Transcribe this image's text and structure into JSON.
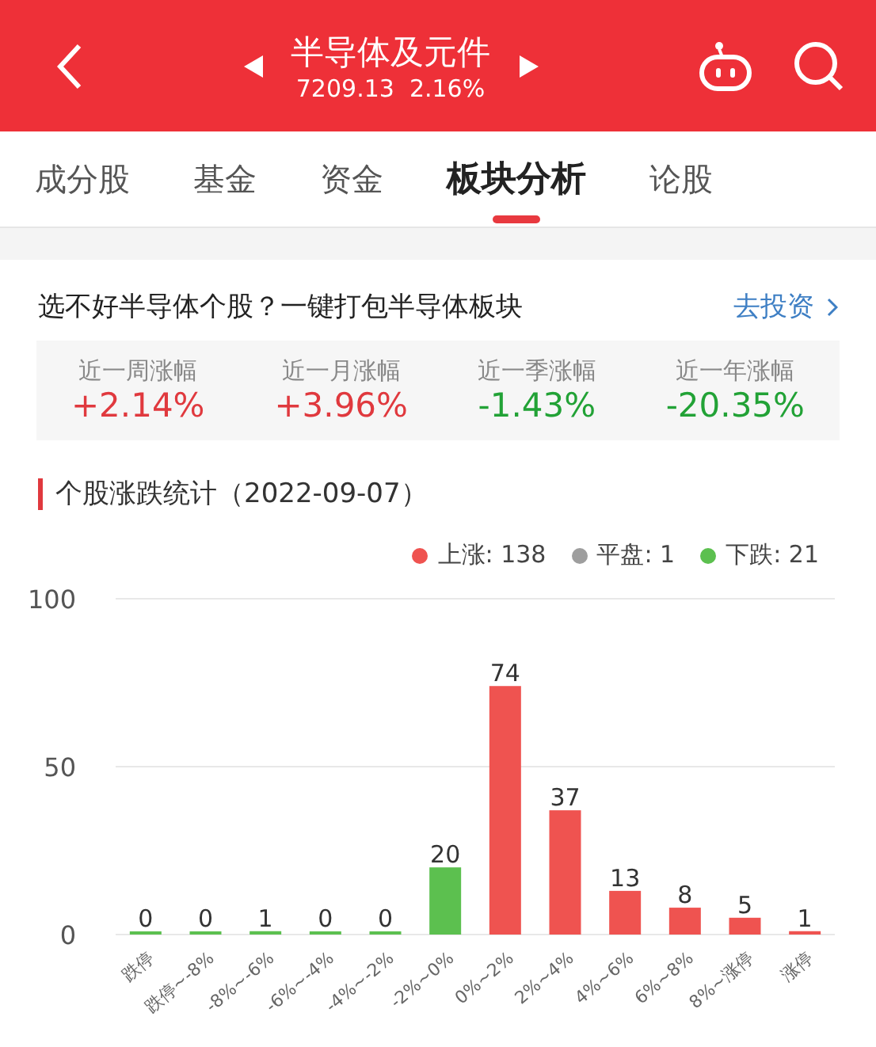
{
  "header": {
    "title": "半导体及元件",
    "quote": "7209.13  2.16%"
  },
  "tabs": [
    {
      "label": "成分股",
      "selected": false
    },
    {
      "label": "基金",
      "selected": false
    },
    {
      "label": "资金",
      "selected": false
    },
    {
      "label": "板块分析",
      "selected": true
    },
    {
      "label": "论股",
      "selected": false
    }
  ],
  "promo": {
    "text": "选不好半导体个股？一键打包半导体板块",
    "link": "去投资"
  },
  "stats": [
    {
      "label": "近一周涨幅",
      "value": "+2.14%",
      "color": "#e0393e"
    },
    {
      "label": "近一月涨幅",
      "value": "+3.96%",
      "color": "#e0393e"
    },
    {
      "label": "近一季涨幅",
      "value": "-1.43%",
      "color": "#22a236"
    },
    {
      "label": "近一年涨幅",
      "value": "-20.35%",
      "color": "#22a236"
    }
  ],
  "section": {
    "title": "个股涨跌统计（2022-09-07）"
  },
  "legend": [
    {
      "label": "上涨: 138",
      "color": "#ef5350"
    },
    {
      "label": "平盘: 1",
      "color": "#9e9e9e"
    },
    {
      "label": "下跌: 21",
      "color": "#5cc04f"
    }
  ],
  "chart_data": {
    "type": "bar",
    "stacked": true,
    "data_labels": true,
    "ylim": [
      0,
      100
    ],
    "yticks": [
      0,
      50,
      100
    ],
    "categories": [
      "跌停",
      "跌停~-8%",
      "-8%~-6%",
      "-6%~-4%",
      "-4%~-2%",
      "-2%~0%",
      "0%~2%",
      "2%~4%",
      "4%~6%",
      "6%~8%",
      "8%~涨停",
      "涨停"
    ],
    "series": [
      {
        "color": "#5cc04f",
        "values": [
          0,
          0,
          1,
          0,
          0,
          20,
          null,
          null,
          null,
          null,
          null,
          null
        ]
      },
      {
        "color": "#ef5350",
        "values": [
          null,
          null,
          null,
          null,
          null,
          null,
          74,
          37,
          13,
          8,
          5,
          1
        ]
      }
    ]
  }
}
